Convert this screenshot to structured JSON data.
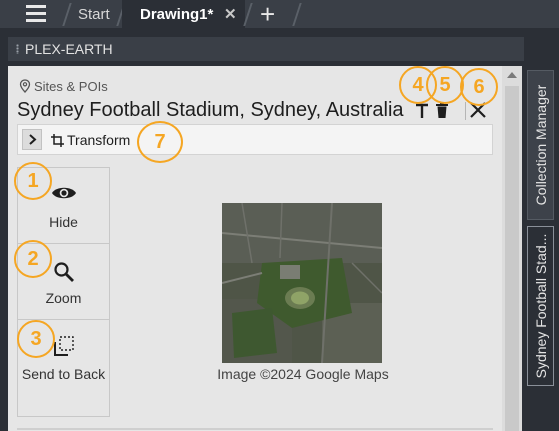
{
  "tabs": {
    "start_label": "Start",
    "drawing_label": "Drawing1*",
    "close_glyph": "✕",
    "add_glyph": "+"
  },
  "palette": {
    "title": "PLEX-EARTH"
  },
  "panel": {
    "breadcrumb": "Sites & POIs",
    "site_title": "Sydney Football Stadium, Sydney, Australia",
    "transform_label": "Transform",
    "map_caption": "Image ©2024 Google Maps",
    "actions": [
      {
        "label": "Hide",
        "icon": "eye-icon"
      },
      {
        "label": "Zoom",
        "icon": "magnifier-icon"
      },
      {
        "label": "Send to Back",
        "icon": "send-to-back-icon"
      }
    ],
    "header_icons": [
      "text-icon",
      "trash-icon",
      "close-icon"
    ]
  },
  "side_tabs": [
    {
      "label": "Collection Manager",
      "active": false
    },
    {
      "label": "Sydney Football Stad...",
      "active": true
    }
  ],
  "callouts": [
    "1",
    "2",
    "3",
    "4",
    "5",
    "6",
    "7"
  ],
  "colors": {
    "callout": "#f5a623",
    "panel_bg": "#e6e6e6",
    "app_bg": "#2b2f36"
  }
}
